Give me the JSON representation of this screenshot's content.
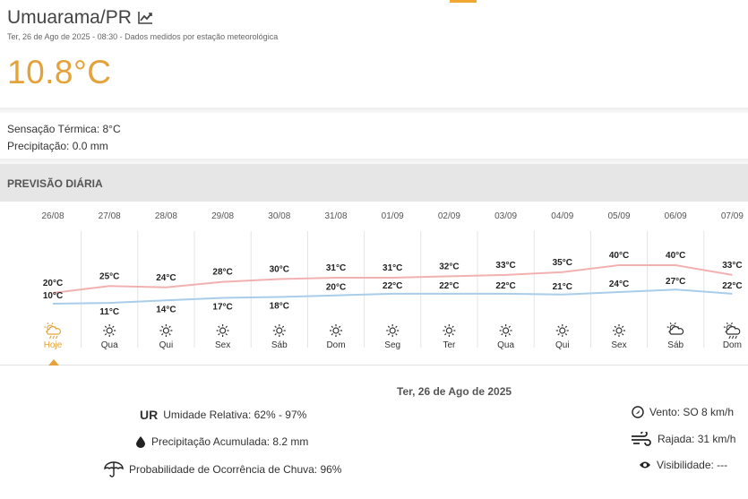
{
  "header": {
    "city": "Umuarama/PR",
    "subtitle": "Ter, 26 de Ago de 2025 - 08:30 - Dados medidos por estação meteorológica",
    "temperature": "10.8°C",
    "chart_icon": "trend-chart-icon"
  },
  "details": {
    "feels_like": "Sensação Térmica: 8°C",
    "precipitation": "Precipitação: 0.0 mm"
  },
  "forecast": {
    "section_title": "PREVISÃO DIÁRIA",
    "days": [
      {
        "date": "26/08",
        "max": "20°C",
        "min": "10°C",
        "label": "Hoje",
        "icon": "cloud-sun-rain-icon",
        "active": true
      },
      {
        "date": "27/08",
        "max": "25°C",
        "min": "11°C",
        "label": "Qua",
        "icon": "sun-icon"
      },
      {
        "date": "28/08",
        "max": "24°C",
        "min": "14°C",
        "label": "Qui",
        "icon": "sun-icon"
      },
      {
        "date": "29/08",
        "max": "28°C",
        "min": "17°C",
        "label": "Sex",
        "icon": "sun-icon"
      },
      {
        "date": "30/08",
        "max": "30°C",
        "min": "18°C",
        "label": "Sáb",
        "icon": "sun-icon"
      },
      {
        "date": "31/08",
        "max": "31°C",
        "min": "20°C",
        "label": "Dom",
        "icon": "sun-icon"
      },
      {
        "date": "01/09",
        "max": "31°C",
        "min": "22°C",
        "label": "Seg",
        "icon": "sun-icon"
      },
      {
        "date": "02/09",
        "max": "32°C",
        "min": "22°C",
        "label": "Ter",
        "icon": "sun-icon"
      },
      {
        "date": "03/09",
        "max": "33°C",
        "min": "22°C",
        "label": "Qua",
        "icon": "sun-icon"
      },
      {
        "date": "04/09",
        "max": "35°C",
        "min": "21°C",
        "label": "Qui",
        "icon": "sun-icon"
      },
      {
        "date": "05/09",
        "max": "40°C",
        "min": "24°C",
        "label": "Sex",
        "icon": "sun-icon"
      },
      {
        "date": "06/09",
        "max": "40°C",
        "min": "27°C",
        "label": "Sáb",
        "icon": "sun-cloud-icon"
      },
      {
        "date": "07/09",
        "max": "33°C",
        "min": "22°C",
        "label": "Dom",
        "icon": "cloud-sun-rain-icon"
      }
    ],
    "colors": {
      "max_line": "#f2b1b1",
      "min_line": "#a9cdea",
      "active": "#e3a23a"
    }
  },
  "selected_day": {
    "title": "Ter, 26 de Ago de 2025",
    "ur_badge": "UR",
    "humidity": "Umidade Relativa: 62% - 97%",
    "accumulated_precip": "Precipitação Acumulada: 8.2 mm",
    "rain_probability": "Probabilidade de Ocorrência de Chuva: 96%",
    "wind": "Vento: SO 8 km/h",
    "gust": "Rajada: 31 km/h",
    "visibility": "Visibilidade: ---"
  }
}
